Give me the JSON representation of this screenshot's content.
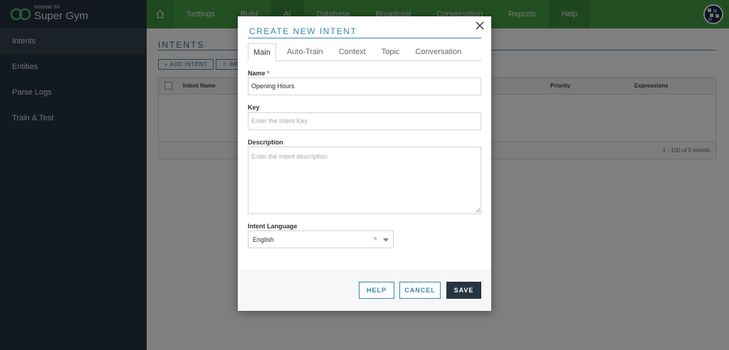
{
  "brand": {
    "company": "Matelab Srl",
    "name": "Super Gym"
  },
  "nav": {
    "items": [
      "Settings",
      "Build",
      "AI",
      "Database",
      "Broadcast",
      "Conversation",
      "Reports",
      "Help"
    ]
  },
  "sidebar": {
    "items": [
      "Intents",
      "Entities",
      "Parse Logs",
      "Train & Test"
    ]
  },
  "page": {
    "title": "INTENTS",
    "add_button": "+ ADD INTENT",
    "import_button": "⇧ IMPORT",
    "columns": [
      "Intent Name",
      "Priority",
      "Expressions"
    ],
    "pagination": "1 - 100 of 0 intents"
  },
  "modal": {
    "title": "CREATE NEW INTENT",
    "tabs": [
      "Main",
      "Auto-Train",
      "Context",
      "Topic",
      "Conversation"
    ],
    "name_label": "Name",
    "required_mark": "*",
    "name_value": "Opening Hours",
    "key_label": "Key",
    "key_placeholder": "Enter the intent Key",
    "description_label": "Description",
    "description_placeholder": "Enter the intent description",
    "language_label": "Intent Language",
    "language_value": "English",
    "clear_glyph": "×",
    "buttons": {
      "help": "HELP",
      "cancel": "CANCEL",
      "save": "SAVE"
    }
  },
  "colors": {
    "topbar": "#46a046",
    "sidebar": "#253443",
    "accent": "#3787b3",
    "save": "#253443"
  }
}
